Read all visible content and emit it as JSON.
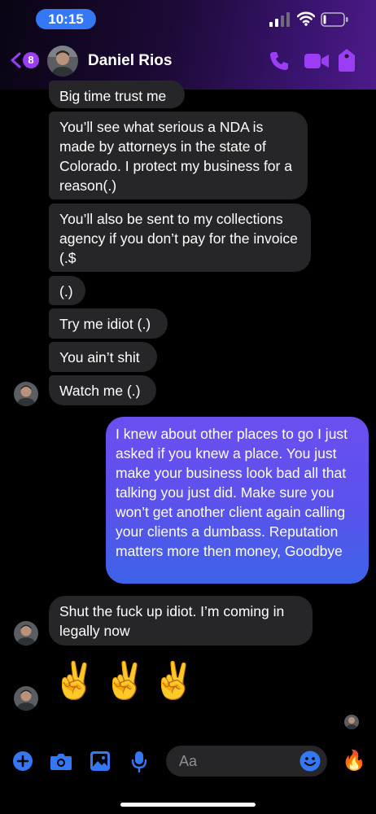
{
  "status_bar": {
    "time": "10:15"
  },
  "header": {
    "back_badge_count": "8",
    "contact_name": "Daniel Rios"
  },
  "messages": [
    {
      "text": "Big time trust me"
    },
    {
      "text": "You’ll see what serious a NDA is made by attorneys in the state of Colorado. I protect my business for a reason(.)"
    },
    {
      "text": "You’ll also be sent to my collections agency if you don’t pay for the invoice (.$"
    },
    {
      "text": "(.)"
    },
    {
      "text": "Try me idiot (.)"
    },
    {
      "text": "You ain’t shit"
    },
    {
      "text": "Watch me (.)"
    },
    {
      "text": "I knew about other places to go I just asked if you knew a place. You just make your business look bad all that talking you just did. Make sure you won’t get another client again calling your clients a dumbass. Reputation matters more then money, Goodbye"
    },
    {
      "text": "Shut the fuck up idiot. I’m coming in legally now"
    },
    {
      "text": "✌️"
    },
    {
      "text": "✌️"
    },
    {
      "text": "✌️"
    }
  ],
  "composer": {
    "placeholder": "Aa",
    "quick_reaction": "🔥"
  },
  "colors": {
    "accent_purple": "#9b3df5",
    "composer_blue": "#3478f6",
    "incoming_bubble": "#262628",
    "outgoing_bubble_top": "#6b4ff0",
    "outgoing_bubble_bottom": "#3d63e8"
  },
  "icons": [
    "back-chevron-icon",
    "phone-icon",
    "video-camera-icon",
    "tag-icon",
    "plus-icon",
    "camera-icon",
    "image-icon",
    "microphone-icon",
    "emoji-icon",
    "fire-icon"
  ]
}
